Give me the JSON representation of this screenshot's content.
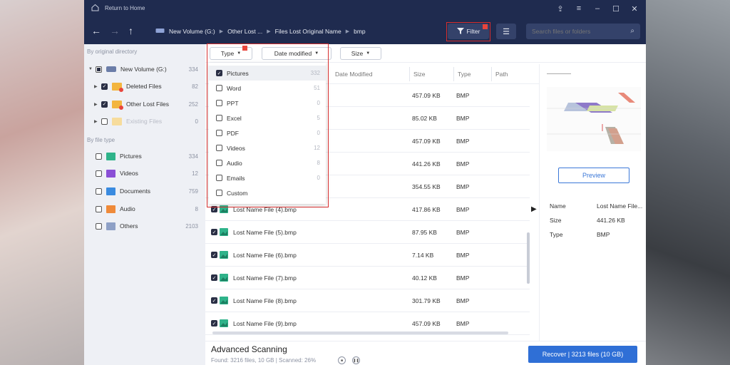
{
  "titlebar": {
    "home_label": "Return to Home"
  },
  "breadcrumb": [
    "New Volume (G:)",
    "Other Lost ...",
    "Files Lost Original Name",
    "bmp"
  ],
  "filter_label": "Filter",
  "search": {
    "placeholder": "Search files or folders"
  },
  "sidebar": {
    "by_dir_heading": "By original directory",
    "dirs": [
      {
        "label": "New Volume (G:)",
        "count": "334"
      },
      {
        "label": "Deleted Files",
        "count": "82"
      },
      {
        "label": "Other Lost Files",
        "count": "252"
      },
      {
        "label": "Existing Files",
        "count": "0"
      }
    ],
    "by_type_heading": "By file type",
    "types": [
      {
        "label": "Pictures",
        "count": "334"
      },
      {
        "label": "Videos",
        "count": "12"
      },
      {
        "label": "Documents",
        "count": "759"
      },
      {
        "label": "Audio",
        "count": "8"
      },
      {
        "label": "Others",
        "count": "2103"
      }
    ]
  },
  "toolbar": {
    "type_label": "Type",
    "date_label": "Date modified",
    "size_label": "Size"
  },
  "columns": {
    "date": "Date Modified",
    "size": "Size",
    "type": "Type",
    "path": "Path"
  },
  "type_dropdown": [
    {
      "label": "Pictures",
      "count": "332"
    },
    {
      "label": "Word",
      "count": "51"
    },
    {
      "label": "PPT",
      "count": "0"
    },
    {
      "label": "Excel",
      "count": "5"
    },
    {
      "label": "PDF",
      "count": "0"
    },
    {
      "label": "Videos",
      "count": "12"
    },
    {
      "label": "Audio",
      "count": "8"
    },
    {
      "label": "Emails",
      "count": "0"
    },
    {
      "label": "Custom",
      "count": ""
    }
  ],
  "files": [
    {
      "name": "",
      "size": "457.09 KB",
      "type": "BMP"
    },
    {
      "name": "",
      "size": "85.02 KB",
      "type": "BMP"
    },
    {
      "name": "",
      "size": "457.09 KB",
      "type": "BMP"
    },
    {
      "name": "",
      "size": "441.26 KB",
      "type": "BMP"
    },
    {
      "name": "",
      "size": "354.55 KB",
      "type": "BMP"
    },
    {
      "name": "Lost Name File (4).bmp",
      "size": "417.86 KB",
      "type": "BMP"
    },
    {
      "name": "Lost Name File (5).bmp",
      "size": "87.95 KB",
      "type": "BMP"
    },
    {
      "name": "Lost Name File (6).bmp",
      "size": "7.14 KB",
      "type": "BMP"
    },
    {
      "name": "Lost Name File (7).bmp",
      "size": "40.12 KB",
      "type": "BMP"
    },
    {
      "name": "Lost Name File (8).bmp",
      "size": "301.79 KB",
      "type": "BMP"
    },
    {
      "name": "Lost Name File (9).bmp",
      "size": "457.09 KB",
      "type": "BMP"
    }
  ],
  "preview": {
    "button": "Preview",
    "name_key": "Name",
    "name_val": "Lost Name File...",
    "size_key": "Size",
    "size_val": "441.26 KB",
    "type_key": "Type",
    "type_val": "BMP"
  },
  "bottom": {
    "title": "Advanced Scanning",
    "stats": "Found: 3216 files, 10 GB  |  Scanned: 26%",
    "recover": "Recover  |  3213 files (10 GB)"
  },
  "colors": {
    "nav": "#1f2b4f",
    "accent": "#2f6fd6",
    "highlight": "#d62e2e"
  }
}
